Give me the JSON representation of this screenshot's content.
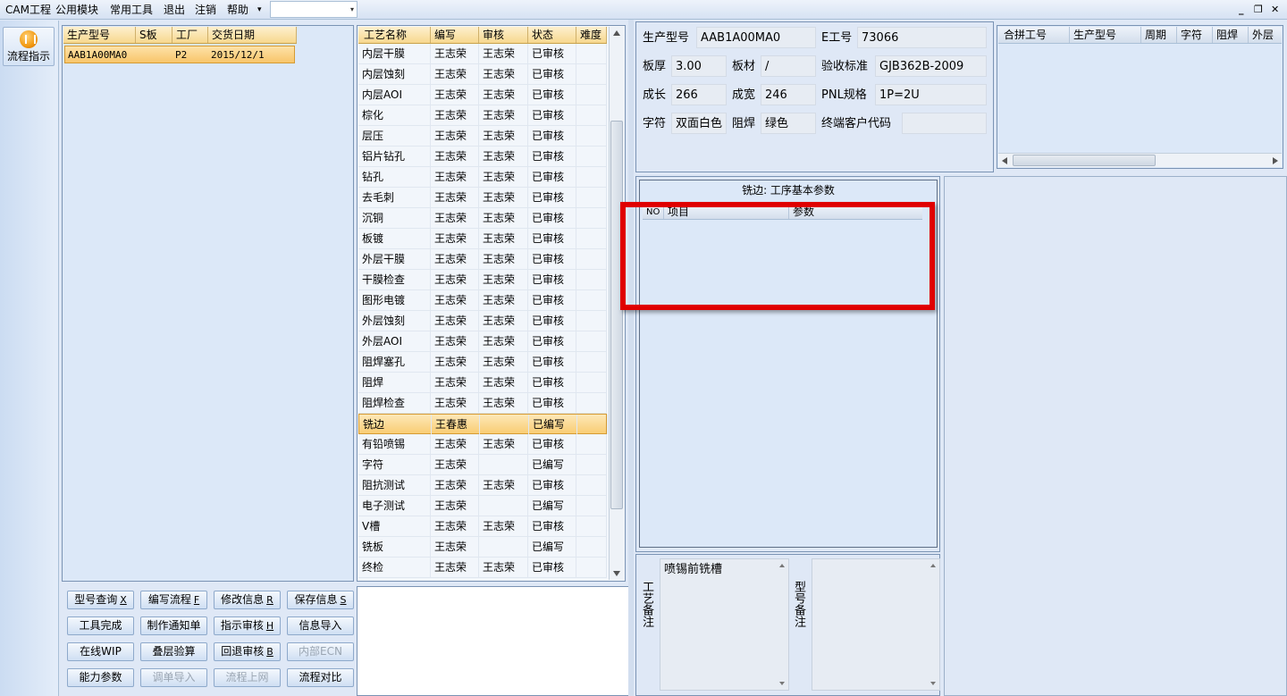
{
  "menu": {
    "items": [
      "CAM工程",
      "公用模块",
      "常用工具",
      "退出",
      "注销",
      "帮助"
    ],
    "dropdown_arrow": "▾",
    "window_controls": [
      "_",
      "❐",
      "✕"
    ]
  },
  "sidebar": {
    "flow_label": "流程指示",
    "flow_icon": "pause-circle-icon"
  },
  "model_grid": {
    "headers": [
      "生产型号",
      "S板",
      "工厂",
      "交货日期"
    ],
    "rows": [
      {
        "model": "AAB1A00MA0",
        "s": "",
        "factory": "P2",
        "date": "2015/12/1"
      }
    ]
  },
  "process_grid": {
    "headers": [
      "工艺名称",
      "编写",
      "审核",
      "状态",
      "难度"
    ],
    "rows": [
      {
        "name": "内层干膜",
        "writer": "王志荣",
        "reviewer": "王志荣",
        "status": "已审核"
      },
      {
        "name": "内层蚀刻",
        "writer": "王志荣",
        "reviewer": "王志荣",
        "status": "已审核"
      },
      {
        "name": "内层AOI",
        "writer": "王志荣",
        "reviewer": "王志荣",
        "status": "已审核"
      },
      {
        "name": "棕化",
        "writer": "王志荣",
        "reviewer": "王志荣",
        "status": "已审核"
      },
      {
        "name": "层压",
        "writer": "王志荣",
        "reviewer": "王志荣",
        "status": "已审核"
      },
      {
        "name": "铝片钻孔",
        "writer": "王志荣",
        "reviewer": "王志荣",
        "status": "已审核"
      },
      {
        "name": "钻孔",
        "writer": "王志荣",
        "reviewer": "王志荣",
        "status": "已审核"
      },
      {
        "name": "去毛刺",
        "writer": "王志荣",
        "reviewer": "王志荣",
        "status": "已审核"
      },
      {
        "name": "沉铜",
        "writer": "王志荣",
        "reviewer": "王志荣",
        "status": "已审核"
      },
      {
        "name": "板镀",
        "writer": "王志荣",
        "reviewer": "王志荣",
        "status": "已审核"
      },
      {
        "name": "外层干膜",
        "writer": "王志荣",
        "reviewer": "王志荣",
        "status": "已审核"
      },
      {
        "name": "干膜检查",
        "writer": "王志荣",
        "reviewer": "王志荣",
        "status": "已审核"
      },
      {
        "name": "图形电镀",
        "writer": "王志荣",
        "reviewer": "王志荣",
        "status": "已审核"
      },
      {
        "name": "外层蚀刻",
        "writer": "王志荣",
        "reviewer": "王志荣",
        "status": "已审核"
      },
      {
        "name": "外层AOI",
        "writer": "王志荣",
        "reviewer": "王志荣",
        "status": "已审核"
      },
      {
        "name": "阻焊塞孔",
        "writer": "王志荣",
        "reviewer": "王志荣",
        "status": "已审核"
      },
      {
        "name": "阻焊",
        "writer": "王志荣",
        "reviewer": "王志荣",
        "status": "已审核"
      },
      {
        "name": "阻焊检查",
        "writer": "王志荣",
        "reviewer": "王志荣",
        "status": "已审核"
      },
      {
        "name": "铣边",
        "writer": "王春惠",
        "reviewer": "",
        "status": "已编写",
        "selected": true
      },
      {
        "name": "有铅喷锡",
        "writer": "王志荣",
        "reviewer": "王志荣",
        "status": "已审核"
      },
      {
        "name": "字符",
        "writer": "王志荣",
        "reviewer": "",
        "status": "已编写"
      },
      {
        "name": "阻抗测试",
        "writer": "王志荣",
        "reviewer": "王志荣",
        "status": "已审核"
      },
      {
        "name": "电子测试",
        "writer": "王志荣",
        "reviewer": "",
        "status": "已编写"
      },
      {
        "name": "V槽",
        "writer": "王志荣",
        "reviewer": "王志荣",
        "status": "已审核"
      },
      {
        "name": "铣板",
        "writer": "王志荣",
        "reviewer": "",
        "status": "已编写"
      },
      {
        "name": "终检",
        "writer": "王志荣",
        "reviewer": "王志荣",
        "status": "已审核"
      }
    ]
  },
  "buttons": [
    {
      "label": "型号查询",
      "key": "X",
      "enabled": true
    },
    {
      "label": "编写流程",
      "key": "F",
      "enabled": true
    },
    {
      "label": "修改信息",
      "key": "R",
      "enabled": true
    },
    {
      "label": "保存信息",
      "key": "S",
      "enabled": true
    },
    {
      "label": "工具完成",
      "key": "",
      "enabled": true
    },
    {
      "label": "制作通知单",
      "key": "",
      "enabled": true
    },
    {
      "label": "指示审核",
      "key": "H",
      "enabled": true
    },
    {
      "label": "信息导入",
      "key": "",
      "enabled": true
    },
    {
      "label": "在线WIP",
      "key": "",
      "enabled": true
    },
    {
      "label": "叠层验算",
      "key": "",
      "enabled": true
    },
    {
      "label": "回退审核",
      "key": "B",
      "enabled": true
    },
    {
      "label": "内部ECN",
      "key": "",
      "enabled": false
    },
    {
      "label": "能力参数",
      "key": "",
      "enabled": true
    },
    {
      "label": "调单导入",
      "key": "",
      "enabled": false
    },
    {
      "label": "流程上网",
      "key": "",
      "enabled": false
    },
    {
      "label": "流程对比",
      "key": "",
      "enabled": true
    }
  ],
  "info": {
    "model_label": "生产型号",
    "model_value": "AAB1A00MA0",
    "e_label": "E工号",
    "e_value": "73066",
    "thick_label": "板厚",
    "thick_value": "3.00",
    "mat_label": "板材",
    "mat_value": "/",
    "std_label": "验收标准",
    "std_value": "GJB362B-2009",
    "len_label": "成长",
    "len_value": "266",
    "wid_label": "成宽",
    "wid_value": "246",
    "pnl_label": "PNL规格",
    "pnl_value": "1P=2U",
    "char_label": "字符",
    "char_value": "双面白色",
    "mask_label": "阻焊",
    "mask_value": "绿色",
    "cust_label": "终端客户代码",
    "cust_value": ""
  },
  "combo_grid": {
    "headers": [
      "合拼工号",
      "生产型号",
      "周期",
      "字符",
      "阻焊",
      "外层"
    ]
  },
  "step_params": {
    "title": "铣边: 工序基本参数",
    "headers": [
      "NO",
      "项目",
      "参数"
    ]
  },
  "notes": {
    "process_label": "工艺备注",
    "process_text": "喷锡前铣槽",
    "model_label": "型号备注",
    "model_text": ""
  },
  "colors": {
    "highlight": "#e00000",
    "selection": "#f9cd74",
    "header": "#f7d88e"
  }
}
